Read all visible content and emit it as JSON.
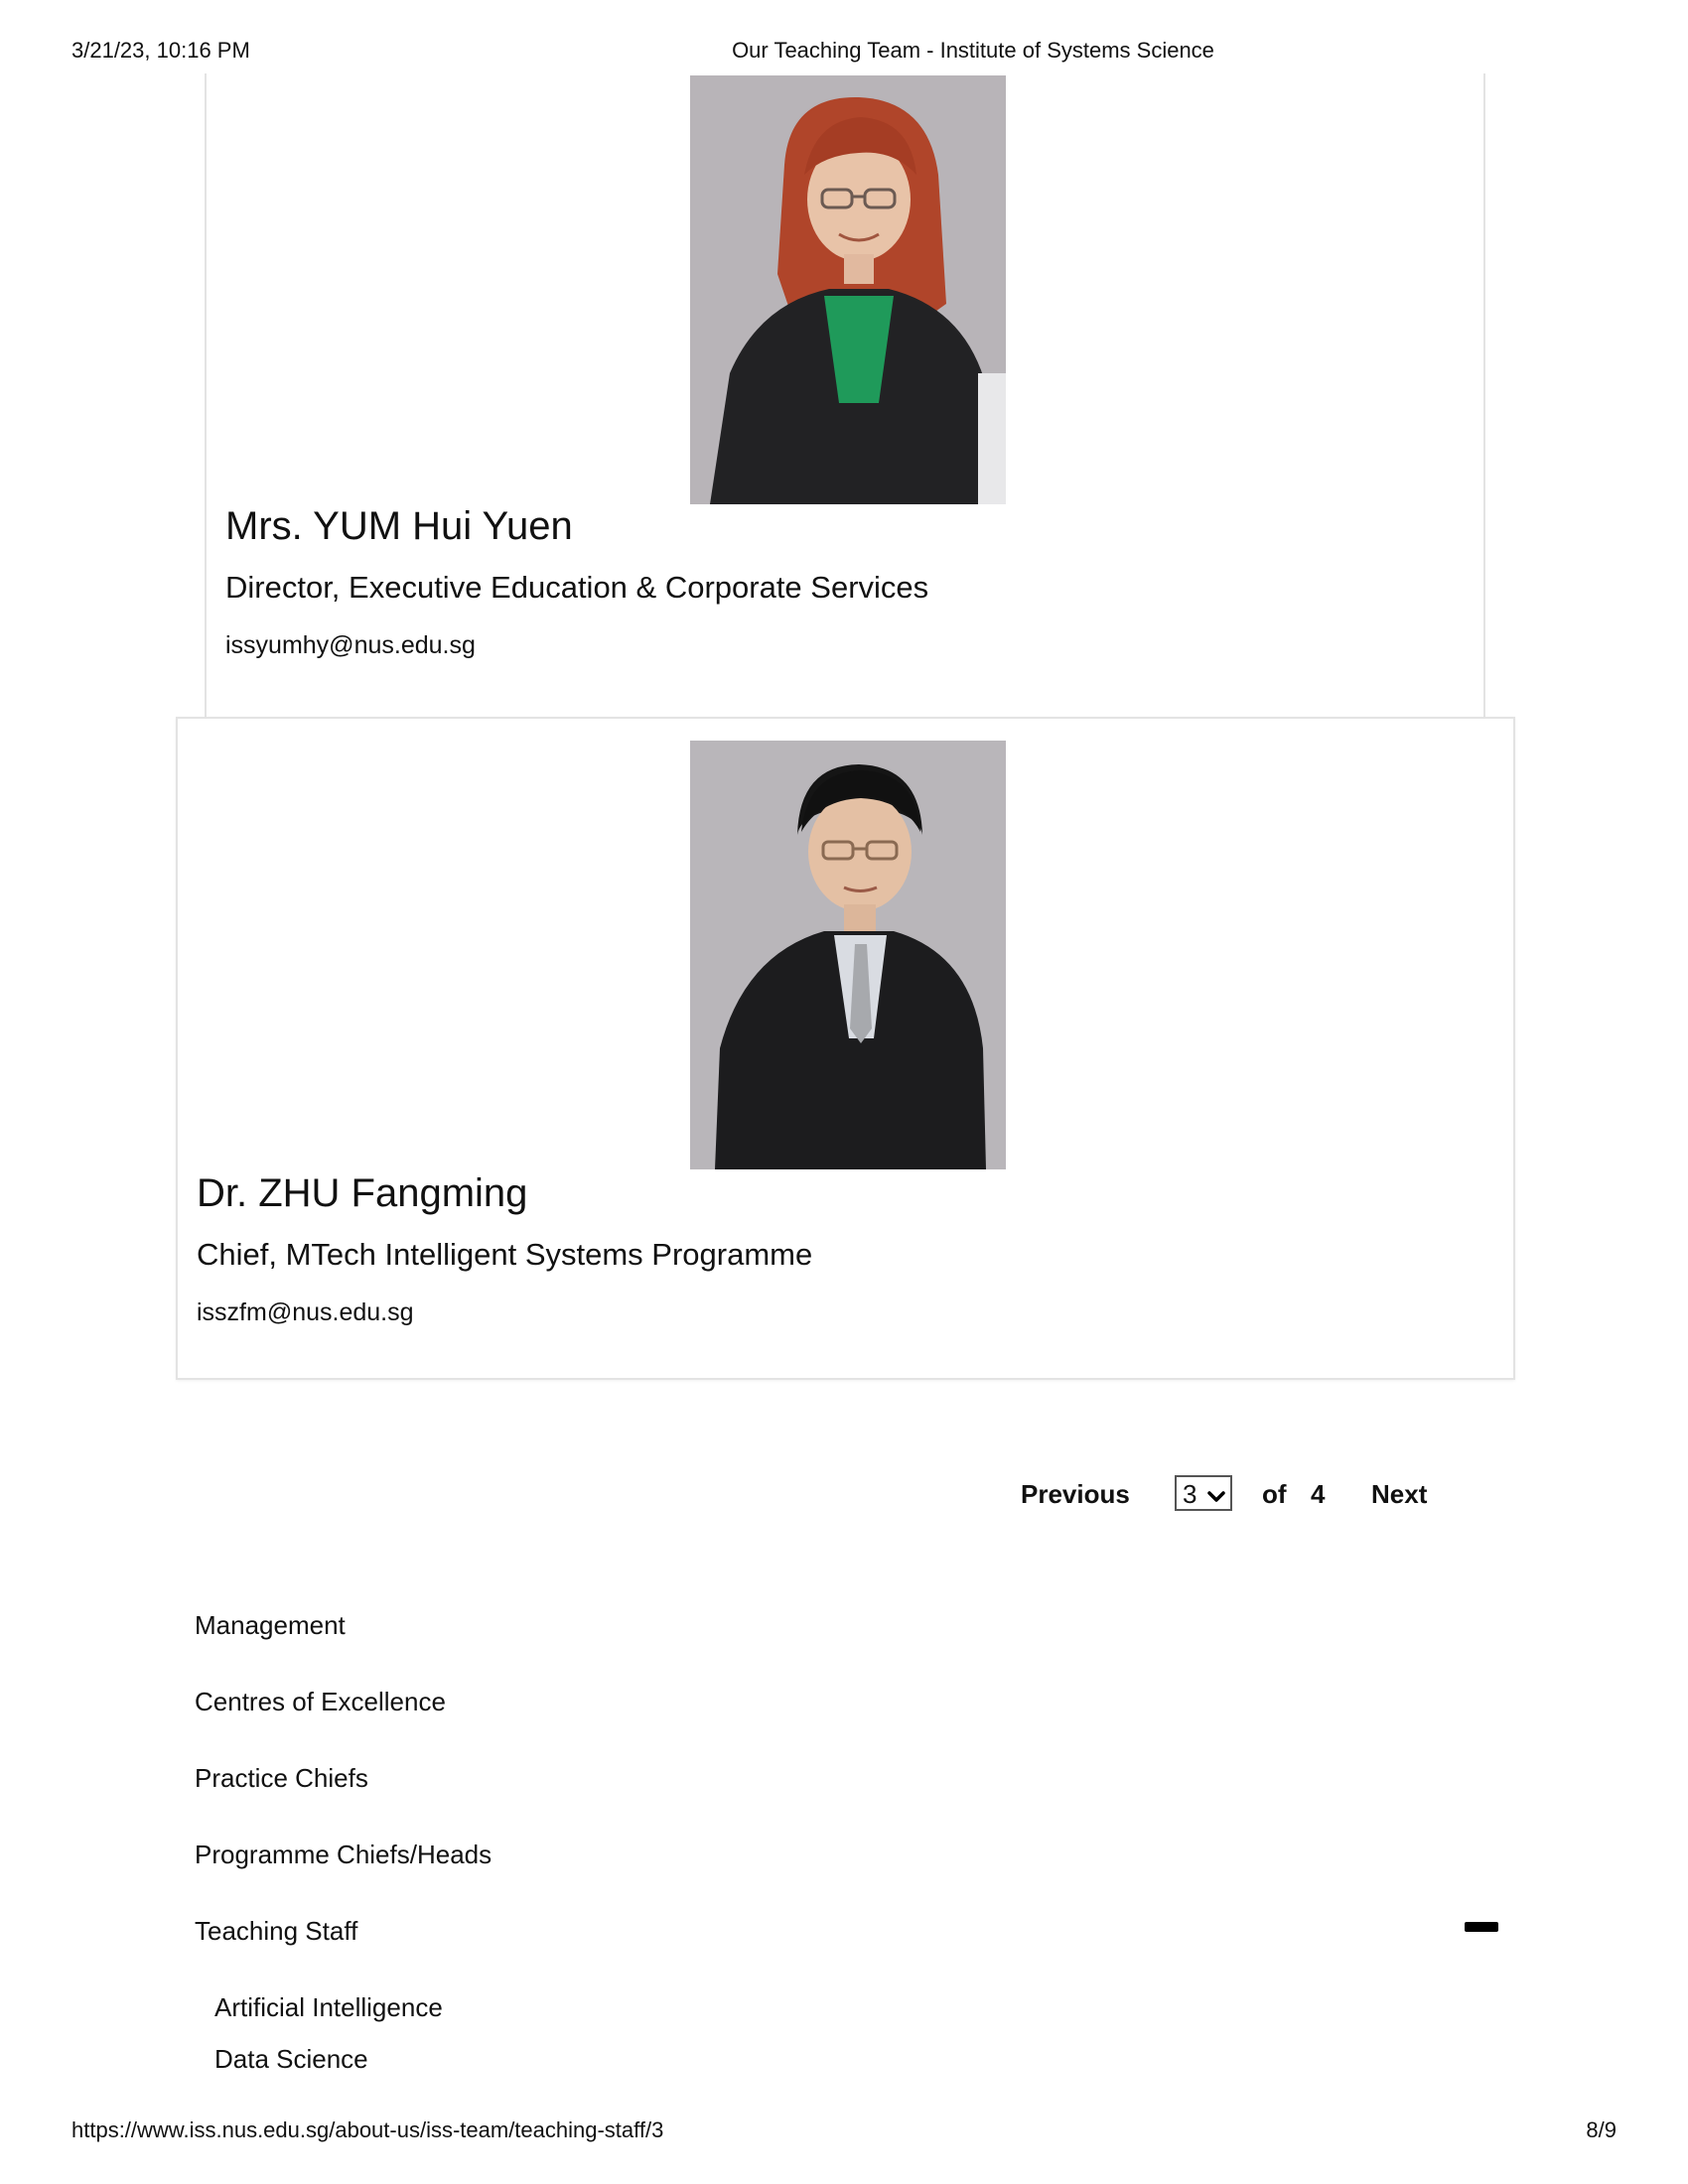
{
  "print_header": {
    "date": "3/21/23, 10:16 PM",
    "title": "Our Teaching Team - Institute of Systems Science"
  },
  "print_footer": {
    "url": "https://www.iss.nus.edu.sg/about-us/iss-team/teaching-staff/3",
    "page": "8/9"
  },
  "staff": [
    {
      "name": "Mrs. YUM Hui Yuen",
      "role": "Director, Executive Education & Corporate Services",
      "email": "issyumhy@nus.edu.sg",
      "photo_icon": "portrait-photo"
    },
    {
      "name": "Dr. ZHU Fangming",
      "role": "Chief, MTech Intelligent Systems Programme",
      "email": "isszfm@nus.edu.sg",
      "photo_icon": "portrait-photo"
    }
  ],
  "pagination": {
    "previous_label": "Previous",
    "current_page": "3",
    "of_label": "of",
    "total_pages": "4",
    "next_label": "Next"
  },
  "nav": {
    "items": [
      "Management",
      "Centres of Excellence",
      "Practice Chiefs",
      "Programme Chiefs/Heads",
      "Teaching Staff"
    ],
    "sub_items": [
      "Artificial Intelligence",
      "Data Science"
    ],
    "collapse_icon": "minus-icon"
  },
  "colors": {
    "card_border": "#e3e3e3",
    "photo_background": "#b9b6ba",
    "text": "#111111"
  }
}
